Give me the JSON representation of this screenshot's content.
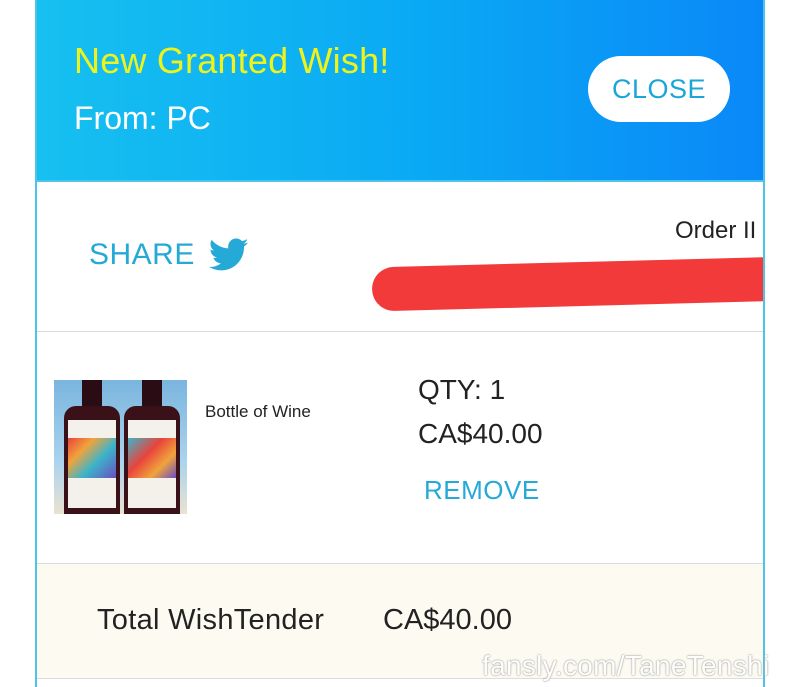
{
  "header": {
    "title": "New Granted Wish!",
    "from": "From: PC",
    "close_label": "CLOSE"
  },
  "share": {
    "label": "SHARE",
    "icon": "twitter-icon",
    "order_label": "Order II"
  },
  "item": {
    "name": "Bottle of Wine",
    "qty": "QTY: 1",
    "price": "CA$40.00",
    "remove_label": "REMOVE"
  },
  "total": {
    "label": "Total WishTender",
    "value": "CA$40.00"
  },
  "watermark": "fansly.com/TaneTenshi",
  "colors": {
    "header_start": "#16c0f0",
    "header_end": "#0a88f8",
    "title": "#eef31c",
    "accent": "#25a9d6",
    "redaction": "#f23a3a",
    "total_bg": "#fdfbf1"
  }
}
